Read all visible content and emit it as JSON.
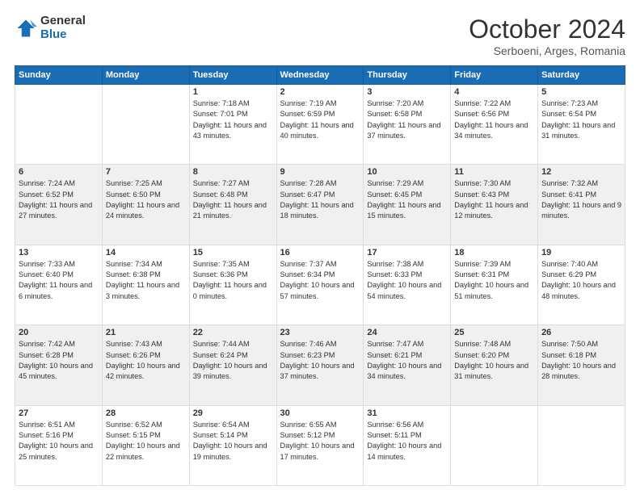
{
  "header": {
    "logo_general": "General",
    "logo_blue": "Blue",
    "month_title": "October 2024",
    "subtitle": "Serboeni, Arges, Romania"
  },
  "days_of_week": [
    "Sunday",
    "Monday",
    "Tuesday",
    "Wednesday",
    "Thursday",
    "Friday",
    "Saturday"
  ],
  "weeks": [
    [
      {
        "day": "",
        "sunrise": "",
        "sunset": "",
        "daylight": ""
      },
      {
        "day": "",
        "sunrise": "",
        "sunset": "",
        "daylight": ""
      },
      {
        "day": "1",
        "sunrise": "Sunrise: 7:18 AM",
        "sunset": "Sunset: 7:01 PM",
        "daylight": "Daylight: 11 hours and 43 minutes."
      },
      {
        "day": "2",
        "sunrise": "Sunrise: 7:19 AM",
        "sunset": "Sunset: 6:59 PM",
        "daylight": "Daylight: 11 hours and 40 minutes."
      },
      {
        "day": "3",
        "sunrise": "Sunrise: 7:20 AM",
        "sunset": "Sunset: 6:58 PM",
        "daylight": "Daylight: 11 hours and 37 minutes."
      },
      {
        "day": "4",
        "sunrise": "Sunrise: 7:22 AM",
        "sunset": "Sunset: 6:56 PM",
        "daylight": "Daylight: 11 hours and 34 minutes."
      },
      {
        "day": "5",
        "sunrise": "Sunrise: 7:23 AM",
        "sunset": "Sunset: 6:54 PM",
        "daylight": "Daylight: 11 hours and 31 minutes."
      }
    ],
    [
      {
        "day": "6",
        "sunrise": "Sunrise: 7:24 AM",
        "sunset": "Sunset: 6:52 PM",
        "daylight": "Daylight: 11 hours and 27 minutes."
      },
      {
        "day": "7",
        "sunrise": "Sunrise: 7:25 AM",
        "sunset": "Sunset: 6:50 PM",
        "daylight": "Daylight: 11 hours and 24 minutes."
      },
      {
        "day": "8",
        "sunrise": "Sunrise: 7:27 AM",
        "sunset": "Sunset: 6:48 PM",
        "daylight": "Daylight: 11 hours and 21 minutes."
      },
      {
        "day": "9",
        "sunrise": "Sunrise: 7:28 AM",
        "sunset": "Sunset: 6:47 PM",
        "daylight": "Daylight: 11 hours and 18 minutes."
      },
      {
        "day": "10",
        "sunrise": "Sunrise: 7:29 AM",
        "sunset": "Sunset: 6:45 PM",
        "daylight": "Daylight: 11 hours and 15 minutes."
      },
      {
        "day": "11",
        "sunrise": "Sunrise: 7:30 AM",
        "sunset": "Sunset: 6:43 PM",
        "daylight": "Daylight: 11 hours and 12 minutes."
      },
      {
        "day": "12",
        "sunrise": "Sunrise: 7:32 AM",
        "sunset": "Sunset: 6:41 PM",
        "daylight": "Daylight: 11 hours and 9 minutes."
      }
    ],
    [
      {
        "day": "13",
        "sunrise": "Sunrise: 7:33 AM",
        "sunset": "Sunset: 6:40 PM",
        "daylight": "Daylight: 11 hours and 6 minutes."
      },
      {
        "day": "14",
        "sunrise": "Sunrise: 7:34 AM",
        "sunset": "Sunset: 6:38 PM",
        "daylight": "Daylight: 11 hours and 3 minutes."
      },
      {
        "day": "15",
        "sunrise": "Sunrise: 7:35 AM",
        "sunset": "Sunset: 6:36 PM",
        "daylight": "Daylight: 11 hours and 0 minutes."
      },
      {
        "day": "16",
        "sunrise": "Sunrise: 7:37 AM",
        "sunset": "Sunset: 6:34 PM",
        "daylight": "Daylight: 10 hours and 57 minutes."
      },
      {
        "day": "17",
        "sunrise": "Sunrise: 7:38 AM",
        "sunset": "Sunset: 6:33 PM",
        "daylight": "Daylight: 10 hours and 54 minutes."
      },
      {
        "day": "18",
        "sunrise": "Sunrise: 7:39 AM",
        "sunset": "Sunset: 6:31 PM",
        "daylight": "Daylight: 10 hours and 51 minutes."
      },
      {
        "day": "19",
        "sunrise": "Sunrise: 7:40 AM",
        "sunset": "Sunset: 6:29 PM",
        "daylight": "Daylight: 10 hours and 48 minutes."
      }
    ],
    [
      {
        "day": "20",
        "sunrise": "Sunrise: 7:42 AM",
        "sunset": "Sunset: 6:28 PM",
        "daylight": "Daylight: 10 hours and 45 minutes."
      },
      {
        "day": "21",
        "sunrise": "Sunrise: 7:43 AM",
        "sunset": "Sunset: 6:26 PM",
        "daylight": "Daylight: 10 hours and 42 minutes."
      },
      {
        "day": "22",
        "sunrise": "Sunrise: 7:44 AM",
        "sunset": "Sunset: 6:24 PM",
        "daylight": "Daylight: 10 hours and 39 minutes."
      },
      {
        "day": "23",
        "sunrise": "Sunrise: 7:46 AM",
        "sunset": "Sunset: 6:23 PM",
        "daylight": "Daylight: 10 hours and 37 minutes."
      },
      {
        "day": "24",
        "sunrise": "Sunrise: 7:47 AM",
        "sunset": "Sunset: 6:21 PM",
        "daylight": "Daylight: 10 hours and 34 minutes."
      },
      {
        "day": "25",
        "sunrise": "Sunrise: 7:48 AM",
        "sunset": "Sunset: 6:20 PM",
        "daylight": "Daylight: 10 hours and 31 minutes."
      },
      {
        "day": "26",
        "sunrise": "Sunrise: 7:50 AM",
        "sunset": "Sunset: 6:18 PM",
        "daylight": "Daylight: 10 hours and 28 minutes."
      }
    ],
    [
      {
        "day": "27",
        "sunrise": "Sunrise: 6:51 AM",
        "sunset": "Sunset: 5:16 PM",
        "daylight": "Daylight: 10 hours and 25 minutes."
      },
      {
        "day": "28",
        "sunrise": "Sunrise: 6:52 AM",
        "sunset": "Sunset: 5:15 PM",
        "daylight": "Daylight: 10 hours and 22 minutes."
      },
      {
        "day": "29",
        "sunrise": "Sunrise: 6:54 AM",
        "sunset": "Sunset: 5:14 PM",
        "daylight": "Daylight: 10 hours and 19 minutes."
      },
      {
        "day": "30",
        "sunrise": "Sunrise: 6:55 AM",
        "sunset": "Sunset: 5:12 PM",
        "daylight": "Daylight: 10 hours and 17 minutes."
      },
      {
        "day": "31",
        "sunrise": "Sunrise: 6:56 AM",
        "sunset": "Sunset: 5:11 PM",
        "daylight": "Daylight: 10 hours and 14 minutes."
      },
      {
        "day": "",
        "sunrise": "",
        "sunset": "",
        "daylight": ""
      },
      {
        "day": "",
        "sunrise": "",
        "sunset": "",
        "daylight": ""
      }
    ]
  ]
}
